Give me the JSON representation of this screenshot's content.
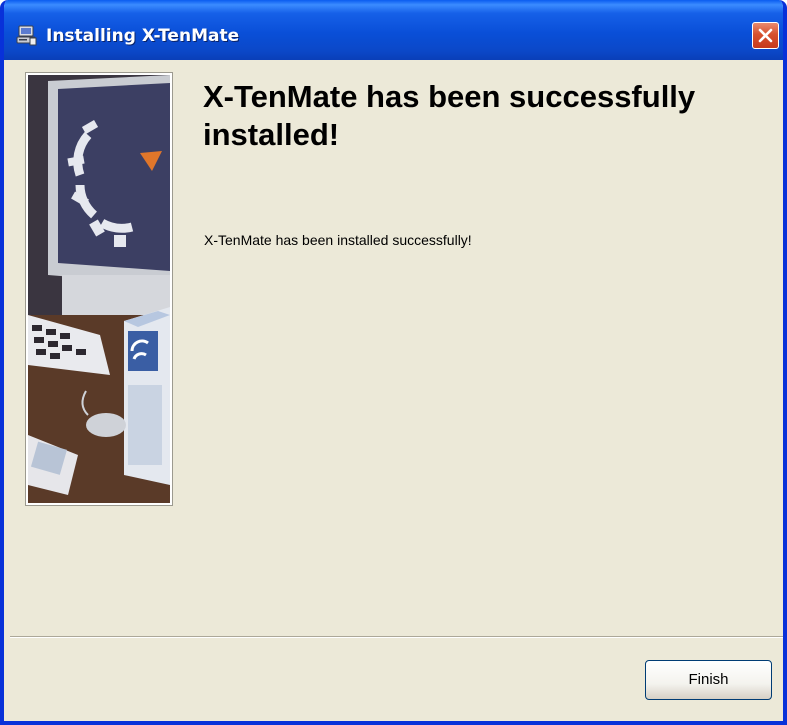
{
  "window": {
    "title": "Installing X-TenMate"
  },
  "content": {
    "heading": "X-TenMate has been successfully installed!",
    "message": "X-TenMate has been installed successfully!"
  },
  "buttons": {
    "finish_label": "Finish"
  },
  "icons": {
    "title": "installer-icon",
    "close": "close-icon"
  },
  "colors": {
    "titlebar": "#0a4fd8",
    "close_button": "#d7512e",
    "dialog_background": "#ece9d8"
  }
}
